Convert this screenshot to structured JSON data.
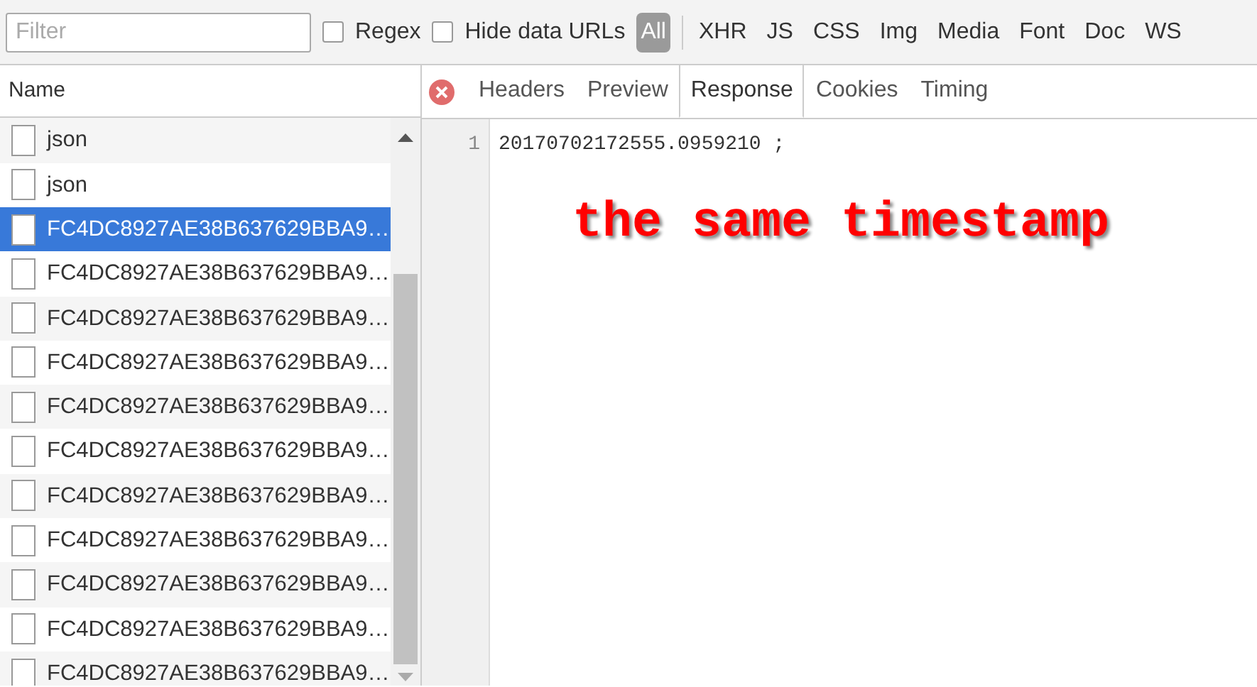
{
  "toolbar": {
    "filter": {
      "placeholder": "Filter"
    },
    "options": [
      {
        "label": "Regex",
        "checked": false
      },
      {
        "label": "Hide data URLs",
        "checked": false
      }
    ],
    "types": [
      {
        "label": "All",
        "selected": true
      },
      {
        "label": "XHR",
        "selected": false
      },
      {
        "label": "JS",
        "selected": false
      },
      {
        "label": "CSS",
        "selected": false
      },
      {
        "label": "Img",
        "selected": false
      },
      {
        "label": "Media",
        "selected": false
      },
      {
        "label": "Font",
        "selected": false
      },
      {
        "label": "Doc",
        "selected": false
      },
      {
        "label": "WS",
        "selected": false
      }
    ]
  },
  "requests": {
    "column": "Name",
    "rows": [
      {
        "name": "json",
        "selected": false
      },
      {
        "name": "json",
        "selected": false
      },
      {
        "name": "FC4DC8927AE38B637629BBA9…",
        "selected": true
      },
      {
        "name": "FC4DC8927AE38B637629BBA9…",
        "selected": false
      },
      {
        "name": "FC4DC8927AE38B637629BBA9…",
        "selected": false
      },
      {
        "name": "FC4DC8927AE38B637629BBA9…",
        "selected": false
      },
      {
        "name": "FC4DC8927AE38B637629BBA9…",
        "selected": false
      },
      {
        "name": "FC4DC8927AE38B637629BBA9…",
        "selected": false
      },
      {
        "name": "FC4DC8927AE38B637629BBA9…",
        "selected": false
      },
      {
        "name": "FC4DC8927AE38B637629BBA9…",
        "selected": false
      },
      {
        "name": "FC4DC8927AE38B637629BBA9…",
        "selected": false
      },
      {
        "name": "FC4DC8927AE38B637629BBA9…",
        "selected": false
      },
      {
        "name": "FC4DC8927AE38B637629BBA9…",
        "selected": false
      }
    ]
  },
  "details": {
    "tabs": [
      {
        "label": "Headers",
        "selected": false
      },
      {
        "label": "Preview",
        "selected": false
      },
      {
        "label": "Response",
        "selected": true
      },
      {
        "label": "Cookies",
        "selected": false
      },
      {
        "label": "Timing",
        "selected": false
      }
    ],
    "lines": [
      {
        "number": "1",
        "code": "20170702172555.0959210 ;"
      }
    ],
    "annotation": "the same timestamp"
  }
}
